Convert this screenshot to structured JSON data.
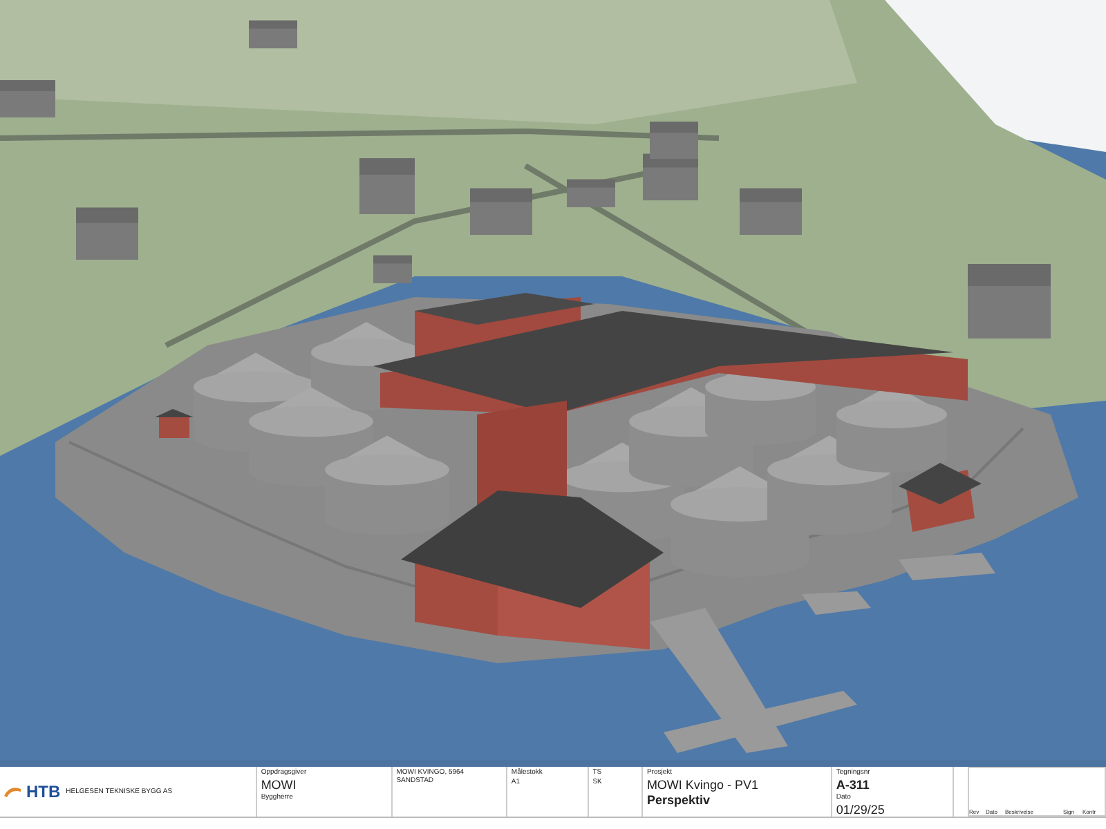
{
  "rendering": {
    "kind": "aerial-perspective"
  },
  "title_block": {
    "logo": "HTB",
    "company": "HELGESEN TEKNISKE BYGG AS",
    "role_label": "Byggherre",
    "client_label": "Oppdragsgiver",
    "client": "MOWI",
    "address": "MOWI KVINGO, 5964 SANDSTAD",
    "scale_label": "Målestokk",
    "paper": "A1",
    "drawn_by": "TS",
    "checked_by": "SK",
    "project_label": "Prosjekt",
    "project": "MOWI Kvingo - PV1",
    "drawing_title": "Perspektiv",
    "drawing_no_label": "Tegningsnr",
    "drawing_no": "A-311",
    "date_label": "Dato",
    "date": "01/29/25",
    "revision_columns": [
      "Rev",
      "Dato",
      "Beskrivelse",
      "Sign",
      "Kontr"
    ]
  }
}
